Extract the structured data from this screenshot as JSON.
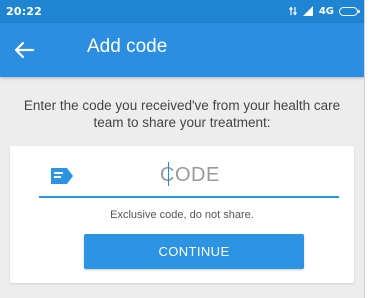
{
  "status_bar": {
    "time": "20:22",
    "network_label": "4G",
    "icons": [
      "data-arrows-icon",
      "signal-icon",
      "battery-icon"
    ]
  },
  "app_bar": {
    "back_icon": "arrow-left-icon",
    "title": "Add code"
  },
  "instructions": "Enter the code you received've from your health care team to share your treatment:",
  "form": {
    "field_icon": "message-icon",
    "code_value": "",
    "code_placeholder": "CODE",
    "hint": "Exclusive code, do not share.",
    "continue_label": "CONTINUE"
  },
  "colors": {
    "status_bar": "#1f85d2",
    "app_bar": "#2c8ee0",
    "accent": "#2d93e3",
    "background": "#ededed"
  }
}
